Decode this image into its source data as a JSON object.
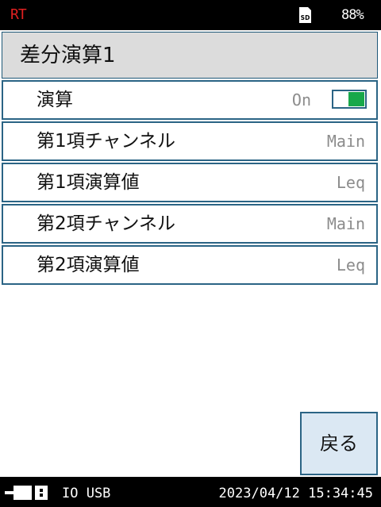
{
  "status_bar": {
    "mode": "RT",
    "sd_label": "SD",
    "battery": "88%"
  },
  "header": {
    "title": "差分演算1"
  },
  "settings": {
    "rows": [
      {
        "label": "演算",
        "value": "On",
        "toggle_state": "on"
      },
      {
        "label": "第1項チャンネル",
        "value": "Main"
      },
      {
        "label": "第1項演算値",
        "value": "Leq"
      },
      {
        "label": "第2項チャンネル",
        "value": "Main"
      },
      {
        "label": "第2項演算値",
        "value": "Leq"
      }
    ]
  },
  "footer": {
    "back_label": "戻る"
  },
  "bottom_bar": {
    "io": "IO USB",
    "datetime": "2023/04/12  15:34:45"
  },
  "colors": {
    "rt": "#e02020",
    "border": "#2b6485",
    "toggle_on": "#18a84a",
    "value_text": "#8c8c8c",
    "title_bg": "#dcdcdc",
    "button_bg": "#dbe8f3"
  },
  "icons": {
    "storage": "sd-card-icon",
    "connection": "connector-icon"
  }
}
